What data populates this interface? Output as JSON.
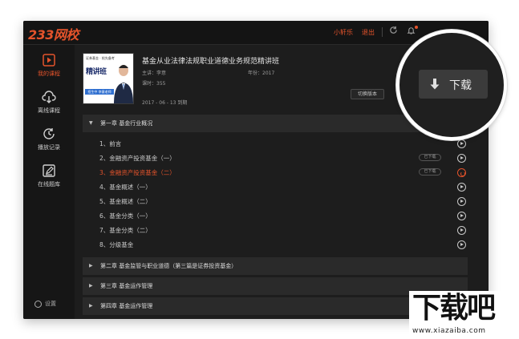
{
  "app": {
    "logo": "233网校",
    "user": "小轩乐",
    "logout": "退出"
  },
  "sidebar": {
    "items": [
      {
        "label": "我的课程",
        "icon": "play-square-icon",
        "active": true
      },
      {
        "label": "离线课程",
        "icon": "cloud-download-icon",
        "active": false
      },
      {
        "label": "播放记录",
        "icon": "clock-history-icon",
        "active": false
      },
      {
        "label": "在线题库",
        "icon": "edit-square-icon",
        "active": false
      }
    ],
    "settings": "设置"
  },
  "course": {
    "title": "基金从业法律法规职业道德业务规范精讲班",
    "teacher": "主讲：李意",
    "year": "年份：2017",
    "lessons": "课时：355",
    "expiry": "2017 - 06 - 13  到期",
    "switch_label": "切换版本",
    "thumb": {
      "top_text": "证券基金 · 抢先备考",
      "title": "精讲班",
      "band": "招生中 李意老师"
    }
  },
  "chapters": [
    {
      "title": "第一章  基金行业概况",
      "expanded": true
    },
    {
      "title": "第二章  基金监管与职业道德（第三篇是证券投资基金）",
      "expanded": false
    },
    {
      "title": "第三章  基金运作管理",
      "expanded": false
    },
    {
      "title": "第四章  基金运作管理",
      "expanded": false
    }
  ],
  "lessons": [
    {
      "label": "1、前言",
      "badge": "",
      "active": false
    },
    {
      "label": "2、金融资产投资基金（一）",
      "badge": "已下载",
      "active": false
    },
    {
      "label": "3、金融资产投资基金（二）",
      "badge": "已下载",
      "active": true
    },
    {
      "label": "4、基金概述（一）",
      "badge": "",
      "active": false
    },
    {
      "label": "5、基金概述（二）",
      "badge": "",
      "active": false
    },
    {
      "label": "6、基金分类（一）",
      "badge": "",
      "active": false
    },
    {
      "label": "7、基金分类（二）",
      "badge": "",
      "active": false
    },
    {
      "label": "8、分级基金",
      "badge": "",
      "active": false
    }
  ],
  "magnifier": {
    "download_label": "下载"
  },
  "watermark": {
    "text": "下载吧",
    "url": "www.xiazaiba.com"
  },
  "colors": {
    "accent": "#e4532b",
    "background": "#1d1d1d",
    "sidebar": "#161616",
    "chapter_bar": "#2a2a2a"
  }
}
